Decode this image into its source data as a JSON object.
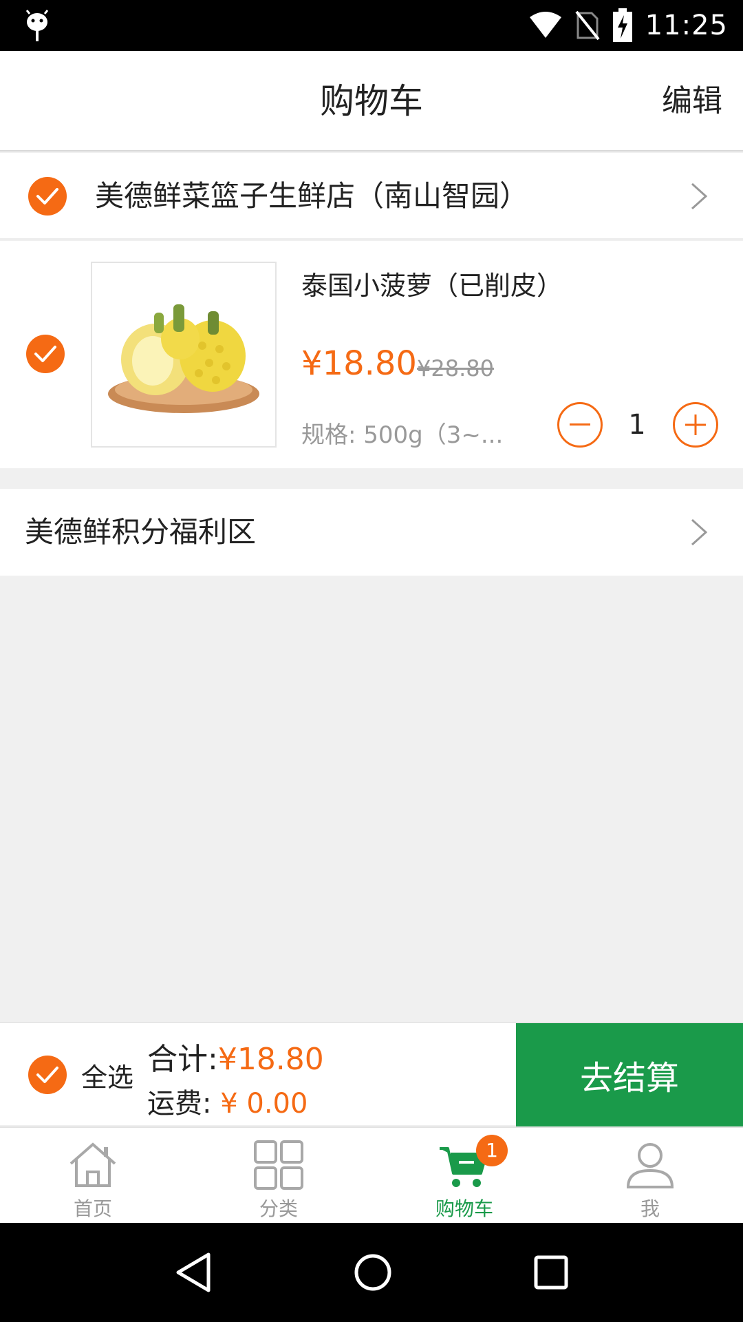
{
  "status_bar": {
    "time": "11:25"
  },
  "header": {
    "title": "购物车",
    "edit_label": "编辑"
  },
  "cart": {
    "store": {
      "name": "美德鲜菜篮子生鲜店（南山智园）",
      "checked": true
    },
    "items": [
      {
        "name": "泰国小菠萝（已削皮）",
        "price": "¥18.80",
        "original_price": "¥28.80",
        "spec": "规格: 500g（3~...",
        "quantity": "1",
        "checked": true
      }
    ],
    "points_section": {
      "label": "美德鲜积分福利区"
    }
  },
  "checkout": {
    "select_all_label": "全选",
    "total_label": "合计:",
    "total_value": "¥18.80",
    "shipping_label": "运费:",
    "shipping_value": "¥ 0.00",
    "button_label": "去结算"
  },
  "tabs": [
    {
      "label": "首页",
      "icon": "home-icon",
      "active": false
    },
    {
      "label": "分类",
      "icon": "grid-icon",
      "active": false
    },
    {
      "label": "购物车",
      "icon": "cart-icon",
      "active": true,
      "badge": "1"
    },
    {
      "label": "我",
      "icon": "user-icon",
      "active": false
    }
  ],
  "colors": {
    "accent_orange": "#f56a14",
    "brand_green": "#1a9a4a",
    "background": "#f0f0f0"
  }
}
